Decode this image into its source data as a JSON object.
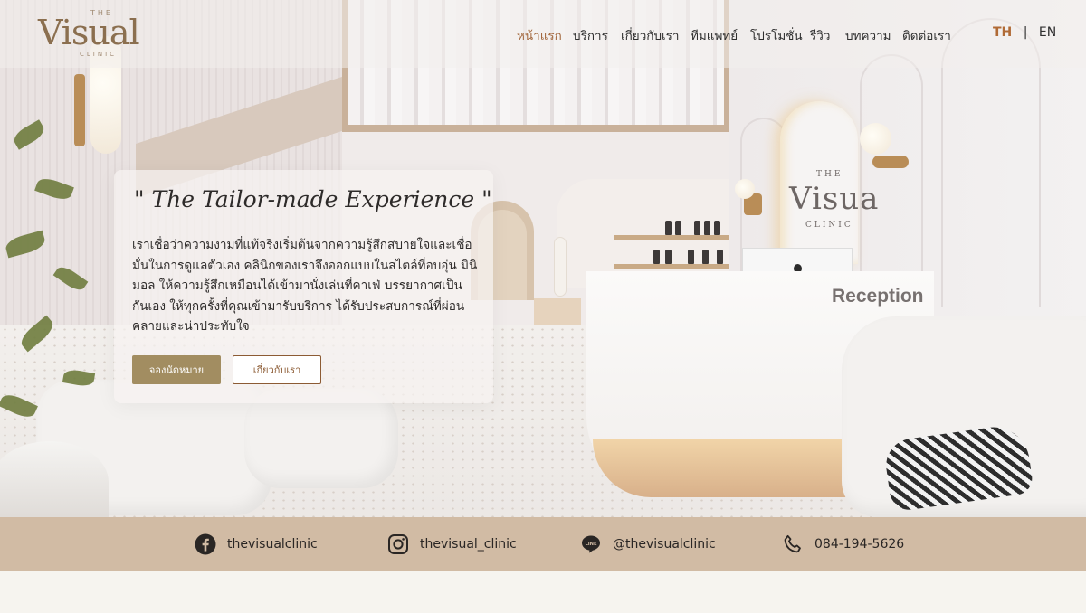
{
  "brand": {
    "logo_the": "THE",
    "logo_main": "Visual",
    "logo_clinic": "CLINIC"
  },
  "nav": {
    "items": [
      {
        "label": "หน้าแรก",
        "active": true
      },
      {
        "label": "บริการ",
        "active": false
      },
      {
        "label": "เกี่ยวกับเรา",
        "active": false
      },
      {
        "label": "ทีมแพทย์",
        "active": false
      },
      {
        "label": "โปรโมชั่น",
        "active": false
      },
      {
        "label": "รีวิว",
        "active": false
      },
      {
        "label": "บทความ",
        "active": false
      },
      {
        "label": "ติดต่อเรา",
        "active": false
      }
    ]
  },
  "language": {
    "th": "TH",
    "separator": "|",
    "en": "EN",
    "selected": "TH"
  },
  "hero": {
    "tagline": "\" The Tailor-made Experience \"",
    "intro": "เราเชื่อว่าความงามที่แท้จริงเริ่มต้นจากความรู้สึกสบายใจและเชื่อมั่นในการดูแลตัวเอง คลินิกของเราจึงออกแบบในสไตล์ที่อบอุ่น มินิมอล ให้ความรู้สึกเหมือนได้เข้ามานั่งเล่นที่คาเฟ่ บรรยากาศเป็นกันเอง ให้ทุกครั้งที่คุณเข้ามารับบริการ ได้รับประสบการณ์ที่ผ่อนคลายและน่าประทับใจ",
    "primary_button": "จองนัดหมาย",
    "secondary_button": "เกี่ยวกับเรา",
    "wall_logo": "Visua",
    "wall_logo_top": "THE",
    "wall_logo_bottom": "CLINIC",
    "reception_sign": "Reception"
  },
  "social": {
    "facebook": {
      "icon": "facebook-icon",
      "label": "thevisualclinic"
    },
    "instagram": {
      "icon": "instagram-icon",
      "label": "thevisual_clinic"
    },
    "line": {
      "icon": "line-icon",
      "label": "@thevisualclinic"
    },
    "phone": {
      "icon": "phone-icon",
      "label": "084-194-5626"
    }
  },
  "colors": {
    "accent": "#a3683e",
    "button_primary": "#a28d61",
    "social_bar": "#d1bba4",
    "page_bg": "#f6f4ef"
  }
}
